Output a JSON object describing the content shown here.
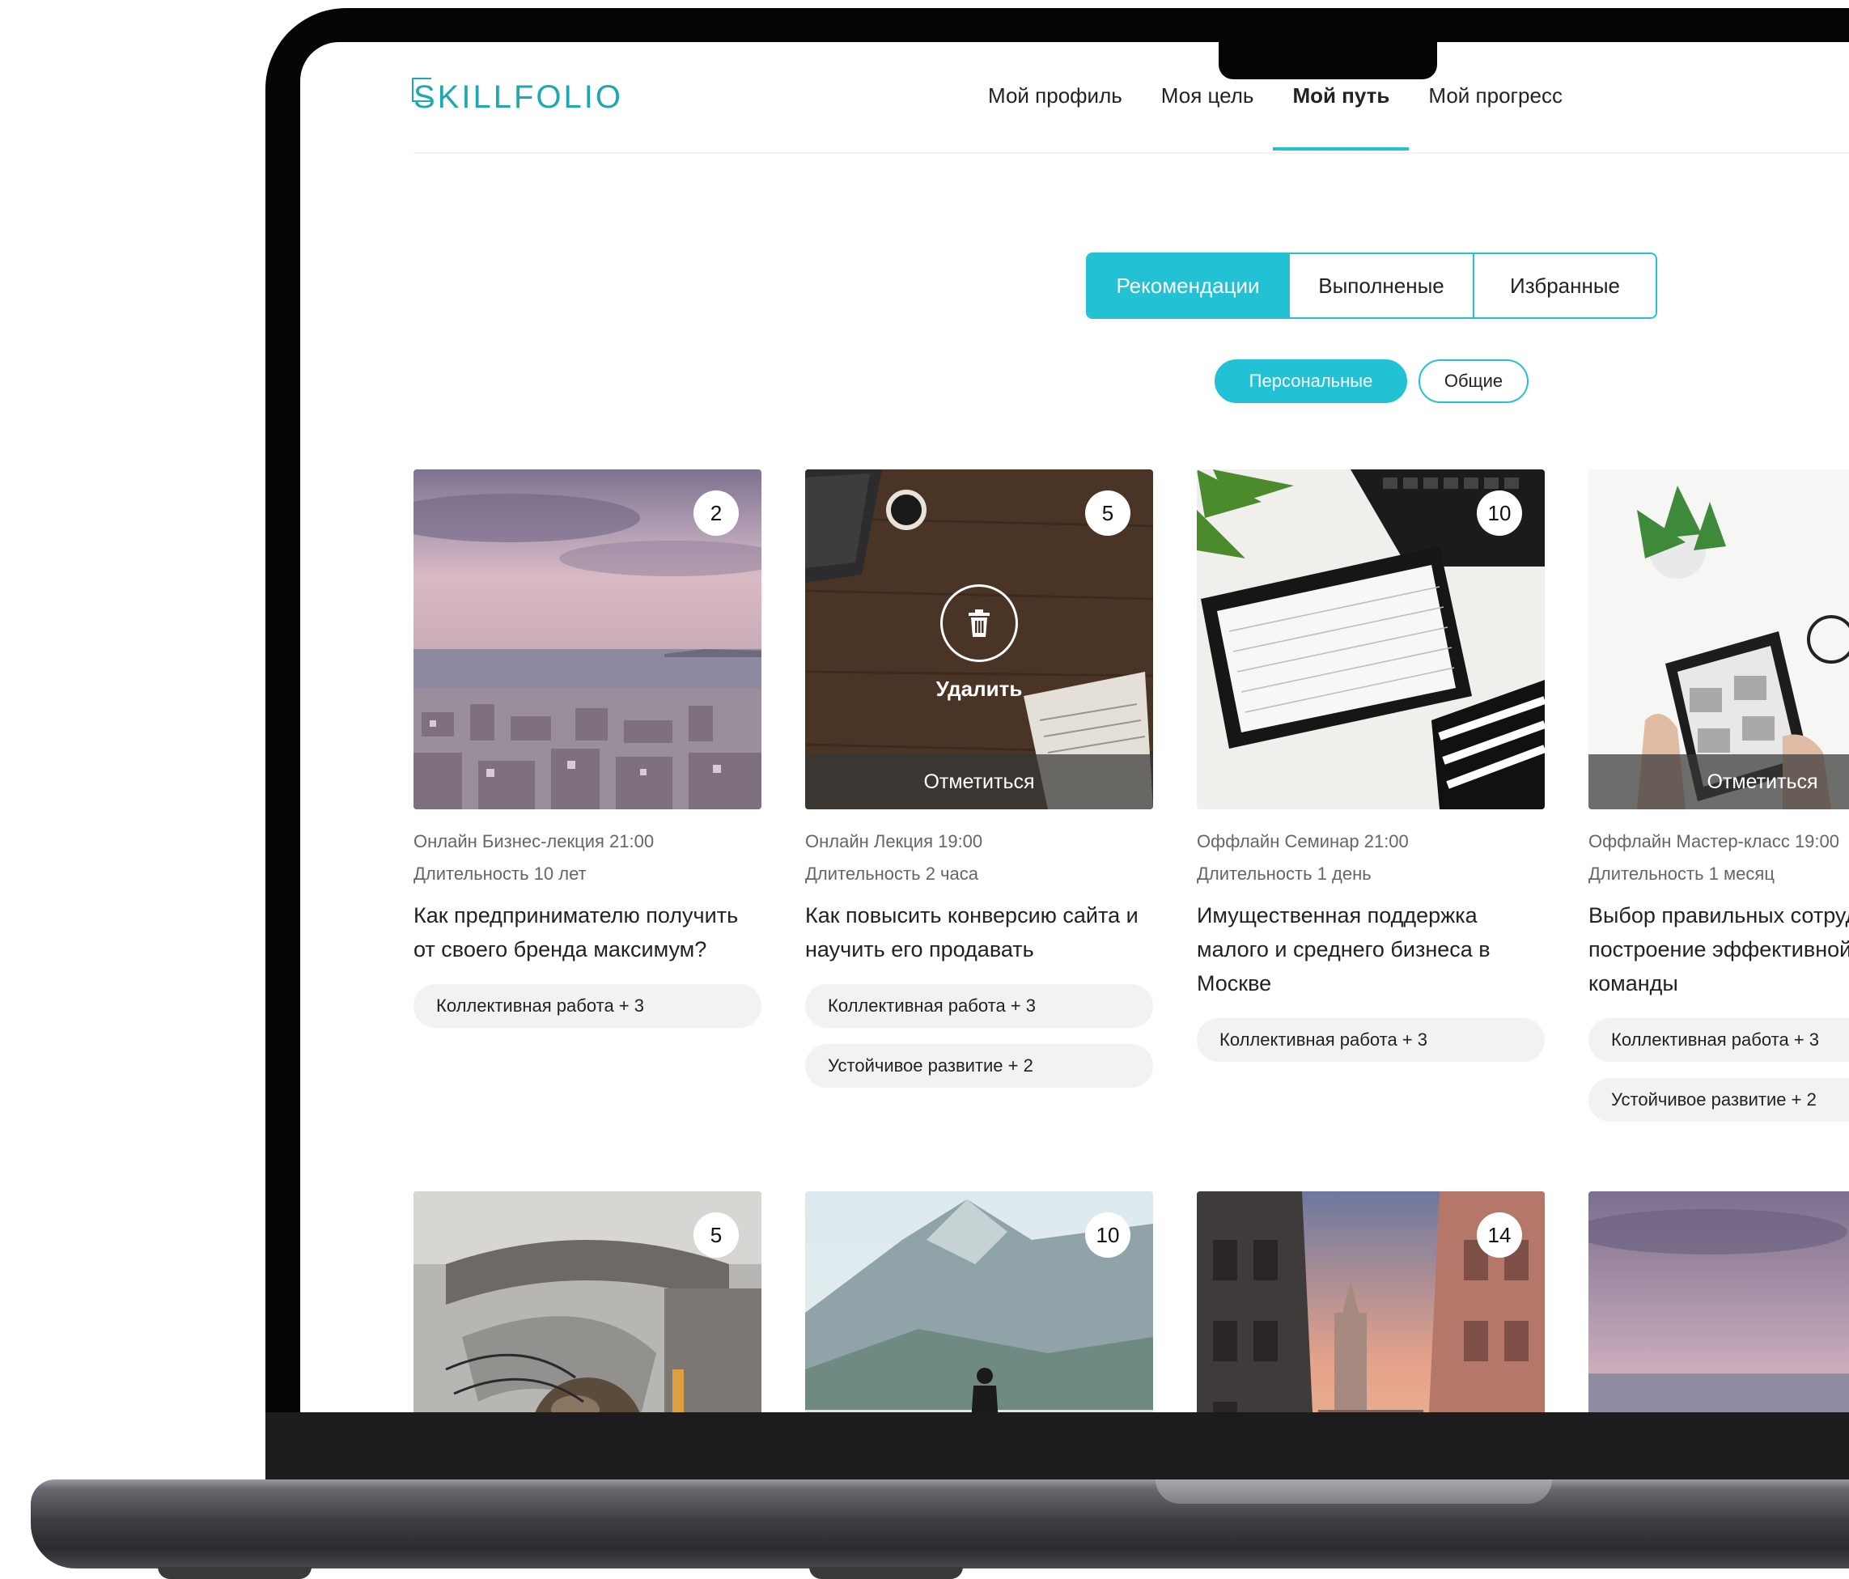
{
  "brand": {
    "logo": "SKILLFOLIO",
    "accent": "#23c1d4",
    "logo_color": "#20a8b0"
  },
  "nav": {
    "items": [
      {
        "label": "Мой профиль"
      },
      {
        "label": "Моя цель"
      },
      {
        "label": "Мой путь",
        "active": true
      },
      {
        "label": "Мой прогресс"
      }
    ]
  },
  "tabs": [
    {
      "label": "Рекомендации",
      "active": true
    },
    {
      "label": "Выполненые"
    },
    {
      "label": "Избранные"
    }
  ],
  "filters": [
    {
      "label": "Персональные",
      "active": true
    },
    {
      "label": "Общие"
    }
  ],
  "cards": [
    {
      "count": "2",
      "meta": "Онлайн Бизнес-лекция 21:00",
      "duration": "Длительность 10 лет",
      "title": "Как предпринимателю получить от своего бренда максимум?",
      "tags": [
        "Коллективная работа + 3"
      ]
    },
    {
      "count": "5",
      "meta": "Онлайн Лекция 19:00",
      "duration": "Длительность 2 часа",
      "title": "Как повысить конверсию сайта и научить его продавать",
      "tags": [
        "Коллективная работа + 3",
        "Устойчивое развитие + 2"
      ],
      "delete_label": "Удалить",
      "overlay_label": "Отметиться"
    },
    {
      "count": "10",
      "meta": "Оффлайн Семинар 21:00",
      "duration": "Длительность 1 день",
      "title": "Имущественная поддержка малого и среднего бизнеса в Москве",
      "tags": [
        "Коллективная работа + 3"
      ]
    },
    {
      "count": "",
      "meta": "Оффлайн Мастер-класс 19:00",
      "duration": "Длительность 1 месяц",
      "title": "Выбор правильных сотрудников и построение эффективной команды",
      "tags": [
        "Коллективная работа + 3",
        "Устойчивое развитие + 2"
      ],
      "overlay_label": "Отметиться"
    },
    {
      "count": "5"
    },
    {
      "count": "10"
    },
    {
      "count": "14"
    },
    {
      "count": ""
    }
  ]
}
